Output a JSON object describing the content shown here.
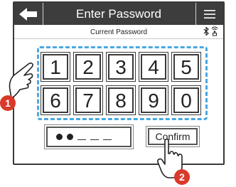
{
  "header": {
    "title": "Enter Password",
    "back_icon": "arrow-left-icon",
    "menu_icon": "hamburger-menu-icon"
  },
  "subtitle": "Current Password",
  "status_icons": [
    "bluetooth-icon",
    "signal-icon"
  ],
  "keypad": {
    "keys": [
      "1",
      "2",
      "3",
      "4",
      "5",
      "6",
      "7",
      "8",
      "9",
      "0"
    ]
  },
  "password_field": {
    "entered_count": 2,
    "remaining_count": 3
  },
  "confirm_label": "Confirm",
  "annotations": {
    "step1": "1",
    "step2": "2"
  },
  "colors": {
    "header_bg": "#3d3d3d",
    "keypad_outline": "#4aa8e0",
    "annotation_badge": "#d9392b"
  }
}
